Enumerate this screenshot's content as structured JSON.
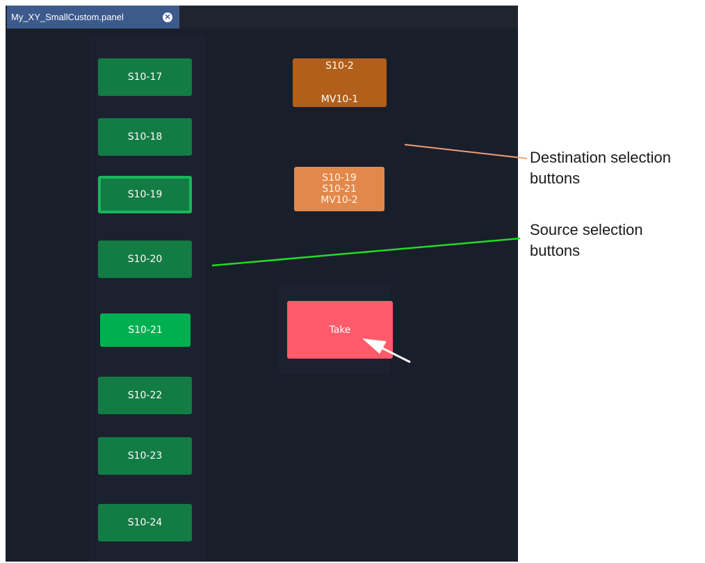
{
  "tab": {
    "title": "My_XY_SmallCustom.panel",
    "close_glyph": "✕"
  },
  "sources": [
    {
      "label": "S10-17",
      "state": "normal"
    },
    {
      "label": "S10-18",
      "state": "normal"
    },
    {
      "label": "S10-19",
      "state": "selected"
    },
    {
      "label": "S10-20",
      "state": "normal"
    },
    {
      "label": "S10-21",
      "state": "active"
    },
    {
      "label": "S10-22",
      "state": "normal"
    },
    {
      "label": "S10-23",
      "state": "normal"
    },
    {
      "label": "S10-24",
      "state": "normal"
    }
  ],
  "destinations": [
    {
      "line1": "S10-2",
      "line2": "MV10-1"
    },
    {
      "line1": "S10-19",
      "line2": "S10-21",
      "line3": "MV10-2"
    }
  ],
  "take": {
    "label": "Take"
  },
  "callouts": {
    "destination": {
      "line1": "Destination selection",
      "line2": "buttons"
    },
    "source": {
      "line1": "Source selection",
      "line2": "buttons"
    }
  },
  "colors": {
    "panel_bg": "#191e2b",
    "source_button": "#137c45",
    "source_active": "#00b050",
    "destination_1": "#b15f1a",
    "destination_2": "#e2884a",
    "take_button": "#ff5b6a",
    "destination_pointer": "#f0a070",
    "source_pointer": "#22dd22"
  }
}
